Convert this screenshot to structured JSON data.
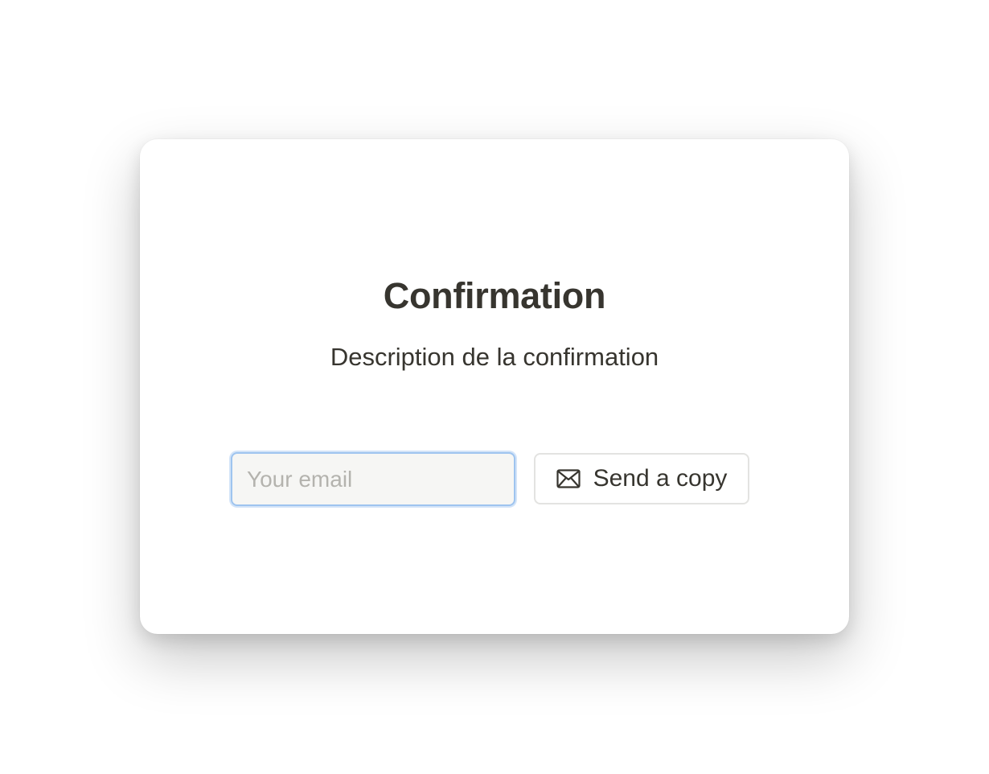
{
  "dialog": {
    "title": "Confirmation",
    "description": "Description de la confirmation",
    "email_field": {
      "value": "",
      "placeholder": "Your email"
    },
    "send_button": {
      "icon": "envelope-icon",
      "label": "Send a copy"
    }
  },
  "colors": {
    "text": "#37352f",
    "placeholder": "#b4b3ae",
    "focus_ring": "#9ec4ef",
    "input_background": "#f6f6f4",
    "button_border": "#e3e3e1"
  }
}
